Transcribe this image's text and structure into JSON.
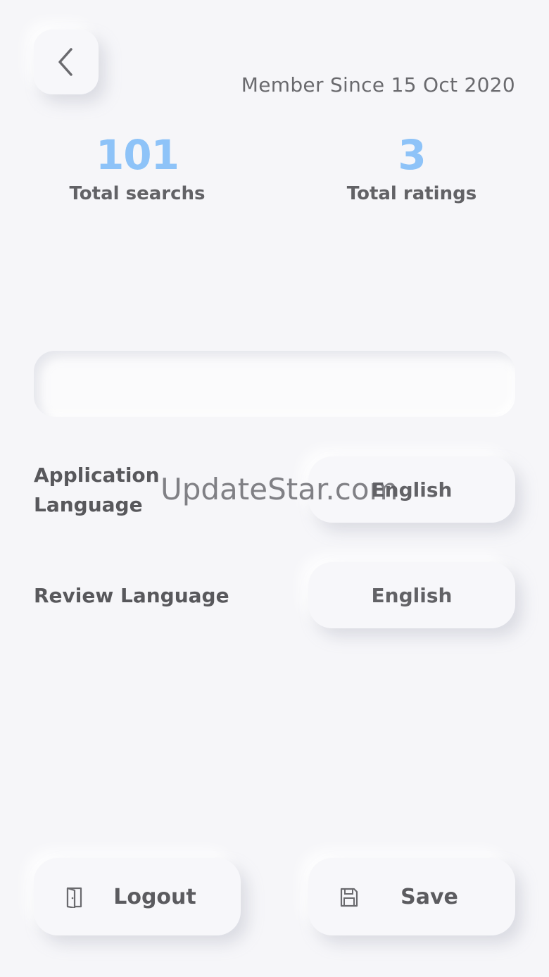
{
  "header": {
    "member_since": "Member Since 15 Oct 2020"
  },
  "stats": [
    {
      "value": "101",
      "label": "Total searchs"
    },
    {
      "value": "3",
      "label": "Total ratings"
    }
  ],
  "search": {
    "value": "",
    "placeholder": ""
  },
  "settings": {
    "app_language_label": "Application Language",
    "app_language_value": "English",
    "review_language_label": "Review Language",
    "review_language_value": "English"
  },
  "watermark": "UpdateStar.com",
  "actions": {
    "logout_label": "Logout",
    "save_label": "Save"
  },
  "colors": {
    "background": "#f6f6f9",
    "accent": "#8ec3f8",
    "text": "#555559"
  },
  "icons": {
    "back": "chevron-left-icon",
    "logout": "door-icon",
    "save": "floppy-disk-icon"
  }
}
